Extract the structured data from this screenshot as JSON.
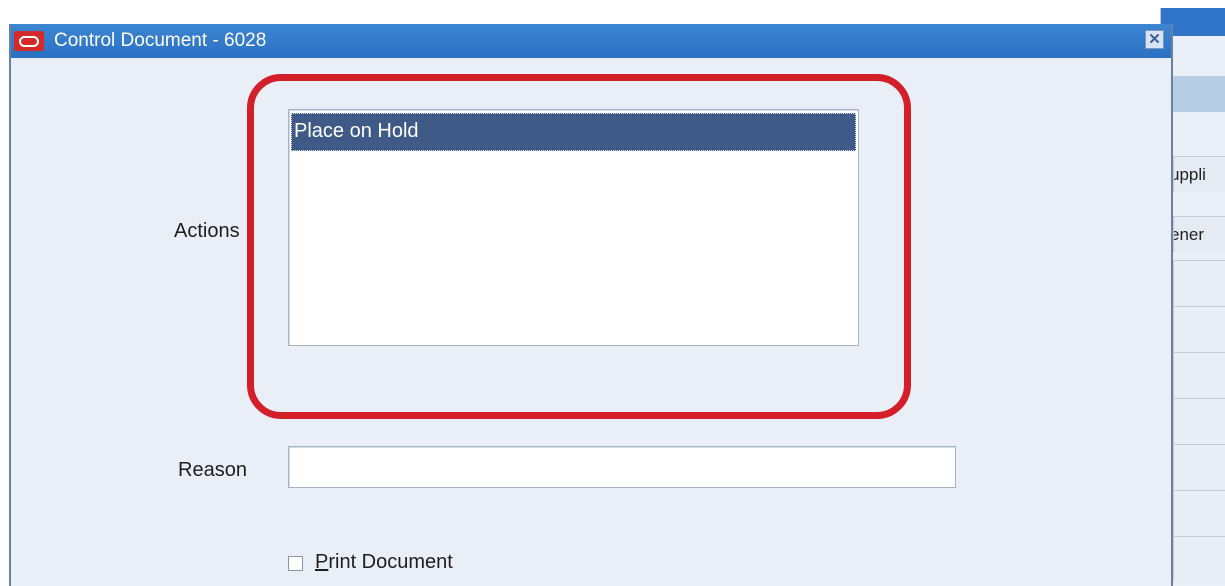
{
  "background_window": {
    "cell_1": "uppli",
    "cell_2": "ener"
  },
  "dialog": {
    "title": "Control Document - 6028",
    "close_icon": "close-icon",
    "app_icon": "oracle-logo-icon"
  },
  "form": {
    "actions_label": "Actions",
    "actions_options": [
      "Place on Hold"
    ],
    "actions_selected": "Place on Hold",
    "reason_label": "Reason",
    "reason_value": "",
    "print_label_mnemonic": "P",
    "print_label_rest": "rint Document",
    "print_checked": false
  },
  "colors": {
    "titlebar": "#2f74c6",
    "selection": "#3f5a86",
    "highlight": "#d41f2a",
    "dialog_bg": "#eaeef6"
  }
}
